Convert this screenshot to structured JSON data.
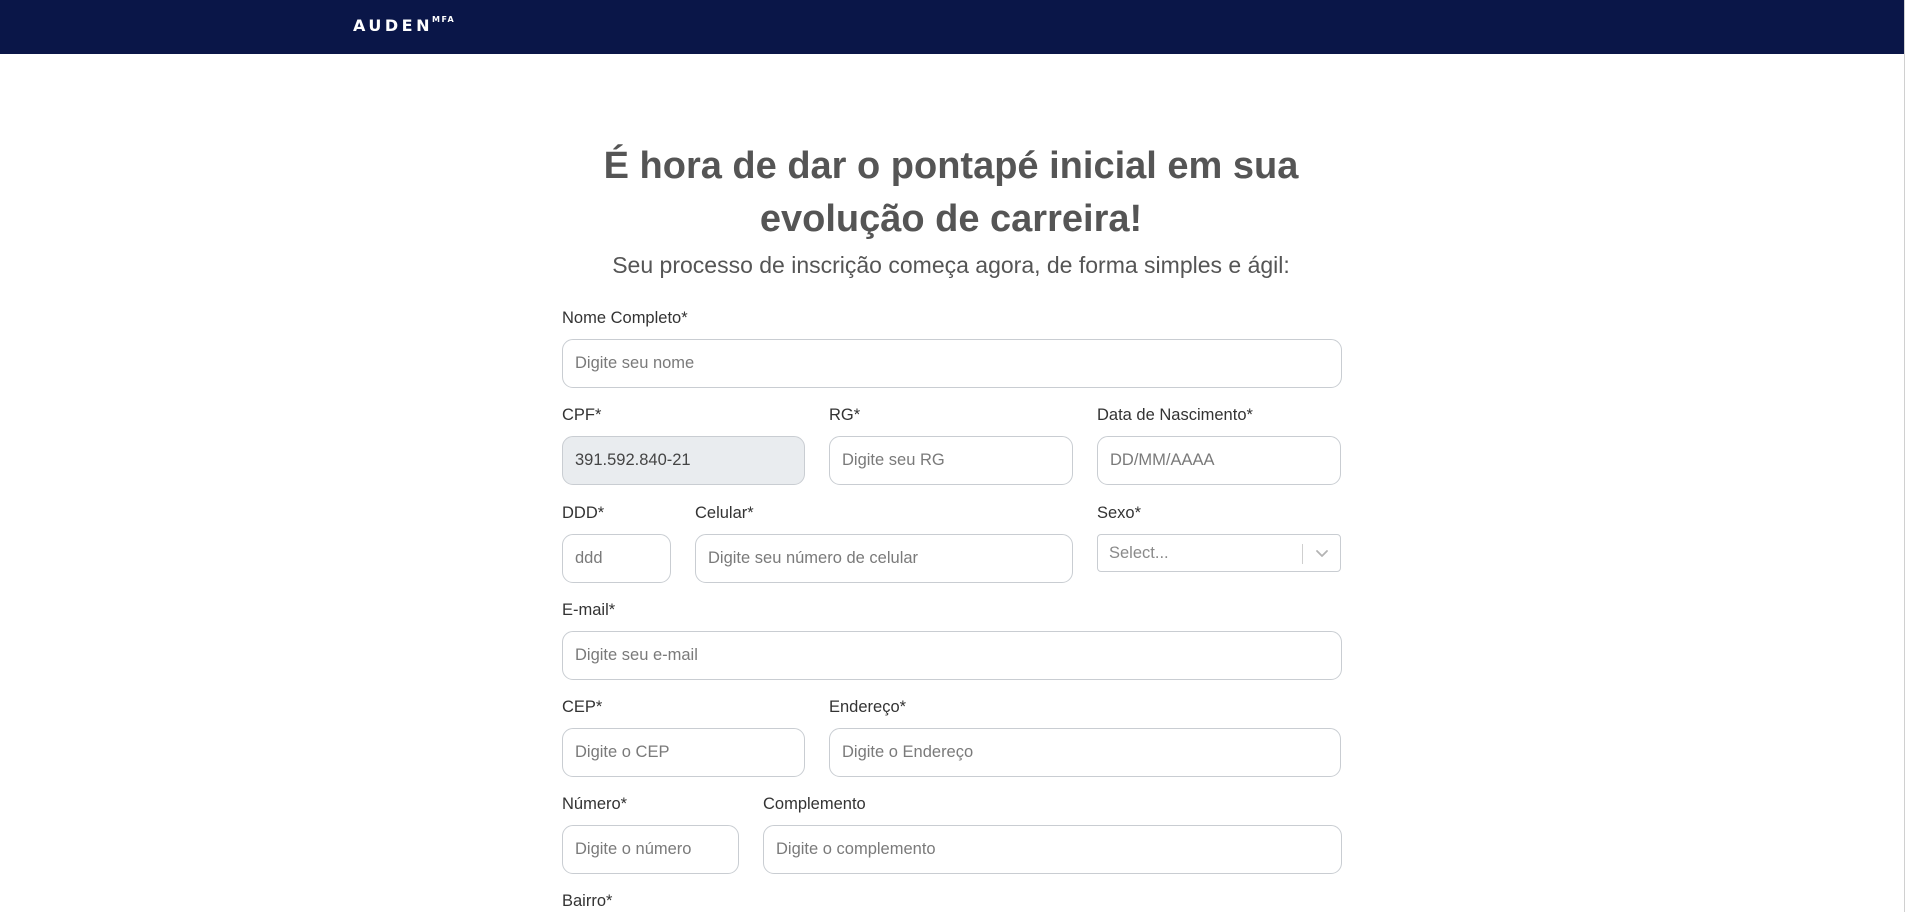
{
  "header": {
    "logo_main": "AUDEN",
    "logo_sup": "MFA"
  },
  "page": {
    "title_line1": "É hora de dar o pontapé inicial em sua",
    "title_line2": "evolução de carreira!",
    "subtitle": "Seu processo de inscrição começa agora, de forma simples e ágil:"
  },
  "form": {
    "nome": {
      "label": "Nome Completo*",
      "placeholder": "Digite seu nome"
    },
    "cpf": {
      "label": "CPF*",
      "value": "391.592.840-21"
    },
    "rg": {
      "label": "RG*",
      "placeholder": "Digite seu RG"
    },
    "nascimento": {
      "label": "Data de Nascimento*",
      "placeholder": "DD/MM/AAAA"
    },
    "ddd": {
      "label": "DDD*",
      "placeholder": "ddd"
    },
    "celular": {
      "label": "Celular*",
      "placeholder": "Digite seu número de celular"
    },
    "sexo": {
      "label": "Sexo*",
      "placeholder": "Select..."
    },
    "email": {
      "label": "E-mail*",
      "placeholder": "Digite seu e-mail"
    },
    "cep": {
      "label": "CEP*",
      "placeholder": "Digite o CEP"
    },
    "endereco": {
      "label": "Endereço*",
      "placeholder": "Digite o Endereço"
    },
    "numero": {
      "label": "Número*",
      "placeholder": "Digite o número"
    },
    "complemento": {
      "label": "Complemento",
      "placeholder": "Digite o complemento"
    },
    "bairro": {
      "label": "Bairro*"
    }
  },
  "icons": {
    "select_arrow": "chevron-down-icon"
  },
  "colors": {
    "header_bg": "#0a1648",
    "heading": "#555555",
    "disabled_field": "#e9ecef"
  }
}
